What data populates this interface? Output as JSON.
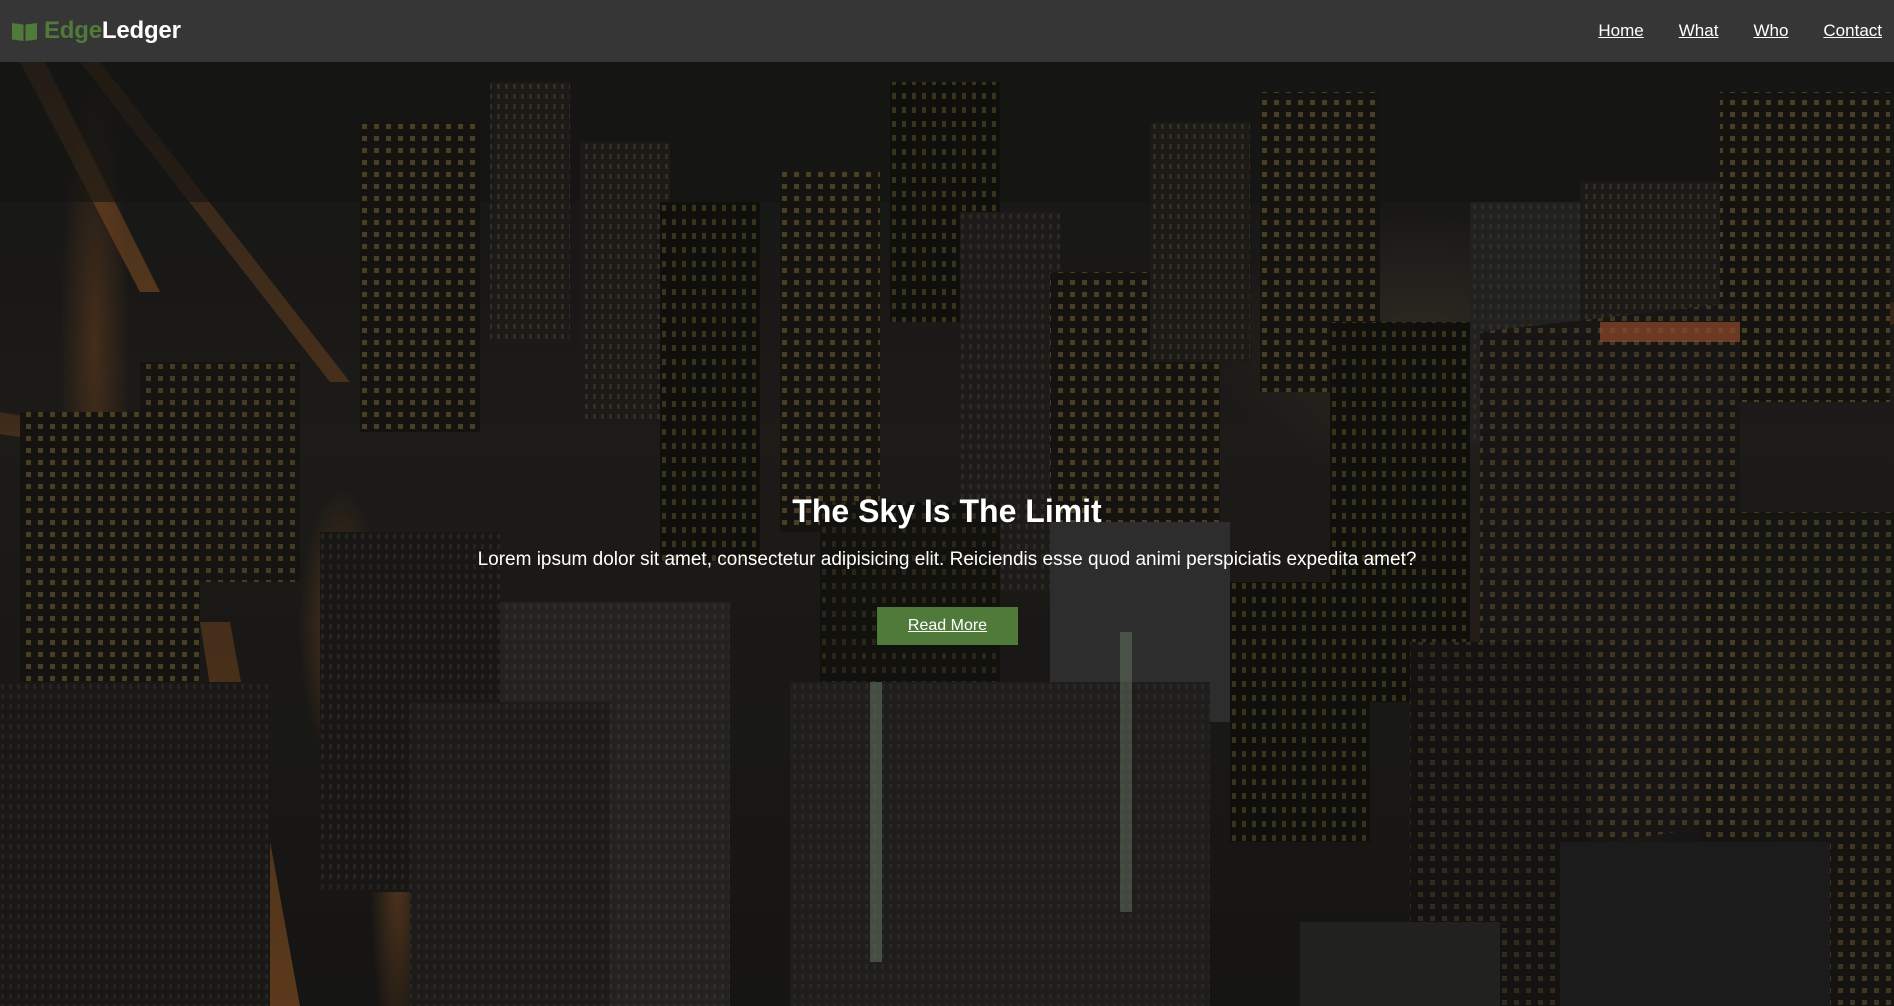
{
  "brand": {
    "icon": "book-icon",
    "part1": "Edge",
    "part2": "Ledger",
    "accent_color": "#4f7a3a"
  },
  "nav": {
    "items": [
      {
        "label": "Home"
      },
      {
        "label": "What"
      },
      {
        "label": "Who"
      },
      {
        "label": "Contact"
      }
    ]
  },
  "hero": {
    "title": "The Sky Is The Limit",
    "text": "Lorem ipsum dolor sit amet, consectetur adipisicing elit. Reiciendis esse quod animi perspiciatis expedita amet?",
    "button_label": "Read More",
    "background": "city-night-aerial-photo"
  },
  "colors": {
    "navbar_bg": "#363636",
    "accent": "#4f7a3a",
    "text": "#ffffff"
  }
}
